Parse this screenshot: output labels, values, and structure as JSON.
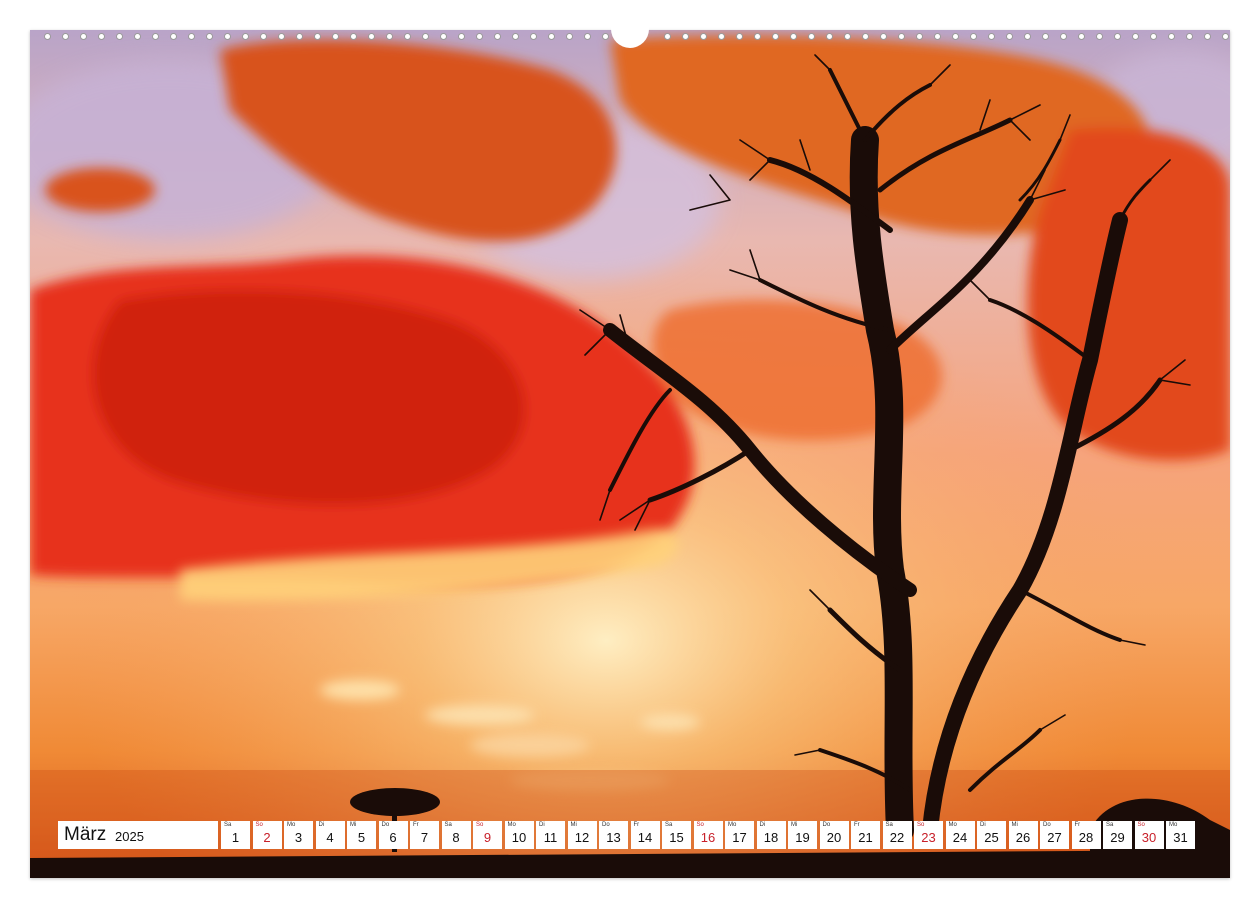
{
  "calendar": {
    "month": "März",
    "year": "2025",
    "days": [
      {
        "wd": "Sa",
        "num": "1",
        "sunday": false
      },
      {
        "wd": "So",
        "num": "2",
        "sunday": true
      },
      {
        "wd": "Mo",
        "num": "3",
        "sunday": false
      },
      {
        "wd": "Di",
        "num": "4",
        "sunday": false
      },
      {
        "wd": "Mi",
        "num": "5",
        "sunday": false
      },
      {
        "wd": "Do",
        "num": "6",
        "sunday": false
      },
      {
        "wd": "Fr",
        "num": "7",
        "sunday": false
      },
      {
        "wd": "Sa",
        "num": "8",
        "sunday": false
      },
      {
        "wd": "So",
        "num": "9",
        "sunday": true
      },
      {
        "wd": "Mo",
        "num": "10",
        "sunday": false
      },
      {
        "wd": "Di",
        "num": "11",
        "sunday": false
      },
      {
        "wd": "Mi",
        "num": "12",
        "sunday": false
      },
      {
        "wd": "Do",
        "num": "13",
        "sunday": false
      },
      {
        "wd": "Fr",
        "num": "14",
        "sunday": false
      },
      {
        "wd": "Sa",
        "num": "15",
        "sunday": false
      },
      {
        "wd": "So",
        "num": "16",
        "sunday": true
      },
      {
        "wd": "Mo",
        "num": "17",
        "sunday": false
      },
      {
        "wd": "Di",
        "num": "18",
        "sunday": false
      },
      {
        "wd": "Mi",
        "num": "19",
        "sunday": false
      },
      {
        "wd": "Do",
        "num": "20",
        "sunday": false
      },
      {
        "wd": "Fr",
        "num": "21",
        "sunday": false
      },
      {
        "wd": "Sa",
        "num": "22",
        "sunday": false
      },
      {
        "wd": "So",
        "num": "23",
        "sunday": true
      },
      {
        "wd": "Mo",
        "num": "24",
        "sunday": false
      },
      {
        "wd": "Di",
        "num": "25",
        "sunday": false
      },
      {
        "wd": "Mi",
        "num": "26",
        "sunday": false
      },
      {
        "wd": "Do",
        "num": "27",
        "sunday": false
      },
      {
        "wd": "Fr",
        "num": "28",
        "sunday": false
      },
      {
        "wd": "Sa",
        "num": "29",
        "sunday": false
      },
      {
        "wd": "So",
        "num": "30",
        "sunday": true
      },
      {
        "wd": "Mo",
        "num": "31",
        "sunday": false
      }
    ]
  },
  "colors": {
    "sunday": "#c8202a",
    "sky_top": "#c9a9c6",
    "cloud_red": "#e8331a",
    "horizon_orange": "#f28a26",
    "silhouette": "#1a0c08"
  }
}
